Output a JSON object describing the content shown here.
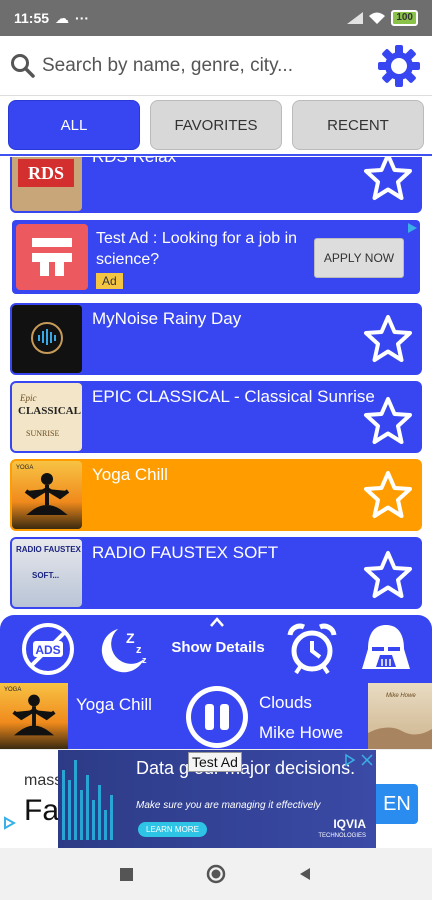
{
  "status": {
    "time": "11:55",
    "battery": "100"
  },
  "search": {
    "placeholder": "Search by name, genre, city..."
  },
  "tabs": [
    {
      "label": "ALL",
      "active": true
    },
    {
      "label": "FAVORITES",
      "active": false
    },
    {
      "label": "RECENT",
      "active": false
    }
  ],
  "stations": [
    {
      "name": "RDS Relax",
      "thumb_text": "RDS"
    },
    {
      "name": "MyNoise Rainy Day"
    },
    {
      "name": "EPIC CLASSICAL - Classical Sunrise",
      "thumb_text_1": "Epic",
      "thumb_text_2": "CLASSICAL",
      "thumb_text_3": "SUNRISE"
    },
    {
      "name": "Yoga Chill",
      "thumb_text": "YOGA"
    },
    {
      "name": "RADIO FAUSTEX SOFT",
      "thumb_text_1": "RADIO FAUSTEX",
      "thumb_text_2": "SOFT..."
    }
  ],
  "list_ad": {
    "text": "Test Ad : Looking for a job in science?",
    "tag": "Ad",
    "button": "APPLY NOW"
  },
  "controls": {
    "show_details": "Show Details",
    "ads_label": "ADS"
  },
  "now_playing": {
    "station": "Yoga Chill",
    "track": "Clouds",
    "artist": "Mike Howe",
    "thumb_text": "YOGA",
    "art_text": "Mike Howe"
  },
  "banner": {
    "left_small": "mass",
    "left_big": "Fa",
    "headline": "Data g    our major decisions.",
    "sub": "Make sure you are managing it effectively",
    "learn": "LEARN MORE",
    "brand": "IQVIA",
    "brand_sub": "TECHNOLOGIES",
    "test_ad": "Test Ad",
    "cta": "EN"
  },
  "colors": {
    "primary": "#3846f2",
    "playing": "#ff9d00",
    "ad_red": "#ec5a5f"
  }
}
